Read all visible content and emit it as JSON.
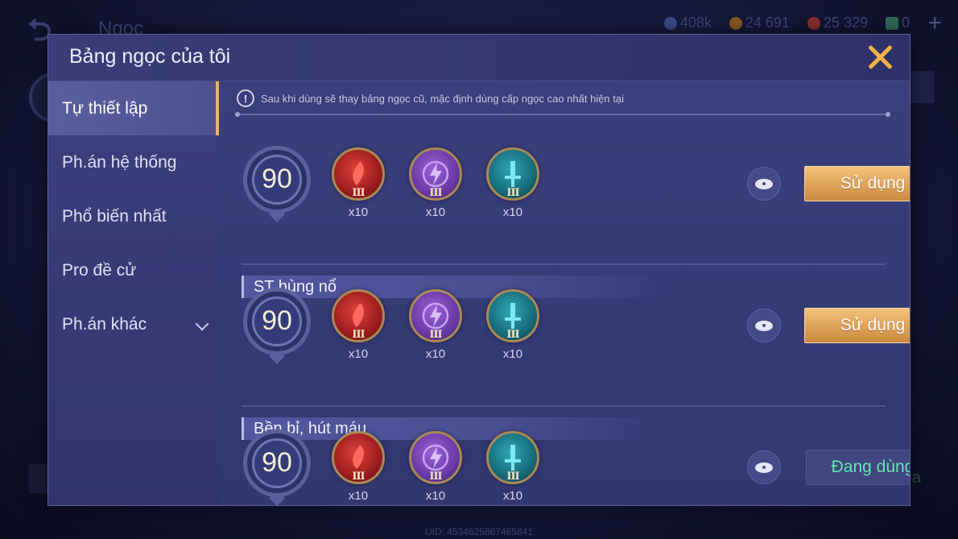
{
  "background": {
    "back_glyph": "⮌",
    "title": "Ngọc",
    "currencies": [
      {
        "value": "408k",
        "color": "#3b4d8a"
      },
      {
        "value": "24 691",
        "color": "#8a5a22"
      },
      {
        "value": "25 329",
        "color": "#8a2f2f"
      },
      {
        "value": "0",
        "color": "#2f6b57"
      }
    ],
    "plus": "+",
    "uid": "UID: 4534625867465841",
    "right_hint": "a"
  },
  "modal": {
    "title": "Bảng ngọc của tôi",
    "close_icon": "close-icon"
  },
  "sidebar": {
    "items": [
      {
        "label": "Tự thiết lập",
        "active": true
      },
      {
        "label": "Ph.án hệ thống"
      },
      {
        "label": "Phổ biến nhất"
      },
      {
        "label": "Pro đề cử"
      },
      {
        "label": "Ph.án khác",
        "has_dropdown": true
      }
    ]
  },
  "notice": {
    "icon": "!",
    "text": "Sau khi dùng sẽ thay bảng ngọc cũ, mặc định dùng cấp ngọc cao nhất hiện tại"
  },
  "presets": [
    {
      "section_title": "",
      "level": "90",
      "gems": [
        {
          "color": "red",
          "icon": "red-gem-icon",
          "tier": "III",
          "qty": "x10"
        },
        {
          "color": "purple",
          "icon": "purple-gem-icon",
          "tier": "III",
          "qty": "x10"
        },
        {
          "color": "teal",
          "icon": "teal-gem-icon",
          "tier": "III",
          "qty": "x10"
        }
      ],
      "button": "Sử dụng",
      "in_use": false
    },
    {
      "section_title": "ST bùng nổ",
      "level": "90",
      "gems": [
        {
          "color": "red",
          "icon": "red-gem-icon",
          "tier": "III",
          "qty": "x10"
        },
        {
          "color": "purple",
          "icon": "purple-gem-icon",
          "tier": "III",
          "qty": "x10"
        },
        {
          "color": "teal",
          "icon": "teal-gem-icon",
          "tier": "III",
          "qty": "x10"
        }
      ],
      "button": "Sử dụng",
      "in_use": false
    },
    {
      "section_title": "Bền bỉ, hút máu",
      "level": "90",
      "gems": [
        {
          "color": "red",
          "icon": "red-gem-icon",
          "tier": "III",
          "qty": "x10"
        },
        {
          "color": "purple",
          "icon": "purple-gem-icon",
          "tier": "III",
          "qty": "x10"
        },
        {
          "color": "teal",
          "icon": "teal-gem-icon",
          "tier": "III",
          "qty": "x10"
        }
      ],
      "button": "Đang dùng",
      "in_use": true
    }
  ]
}
